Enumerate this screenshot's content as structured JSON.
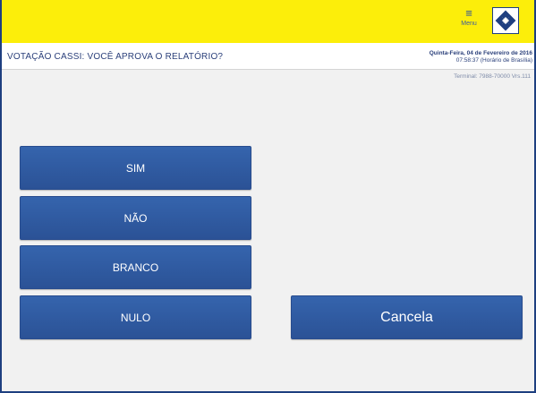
{
  "header": {
    "menu_label": "Menu",
    "menu_icon": "hamburger-icon",
    "logo_icon": "banco-do-brasil-logo-icon"
  },
  "titlebar": {
    "title": "VOTAÇÃO CASSI: VOCÊ APROVA O RELATÓRIO?",
    "date": "Quinta-Feira, 04 de Fevereiro de 2016",
    "time": "07:58:37 (Horário de Brasília)"
  },
  "terminal": "Terminal: 7988-70000 Vrs.111",
  "options": {
    "sim": "SIM",
    "nao": "NÃO",
    "branco": "BRANCO",
    "nulo": "NULO"
  },
  "cancel_label": "Cancela",
  "colors": {
    "topbar": "#fcee0a",
    "button": "#2f5aa1",
    "frame": "#1e3f80",
    "background": "#f1f1f1"
  }
}
